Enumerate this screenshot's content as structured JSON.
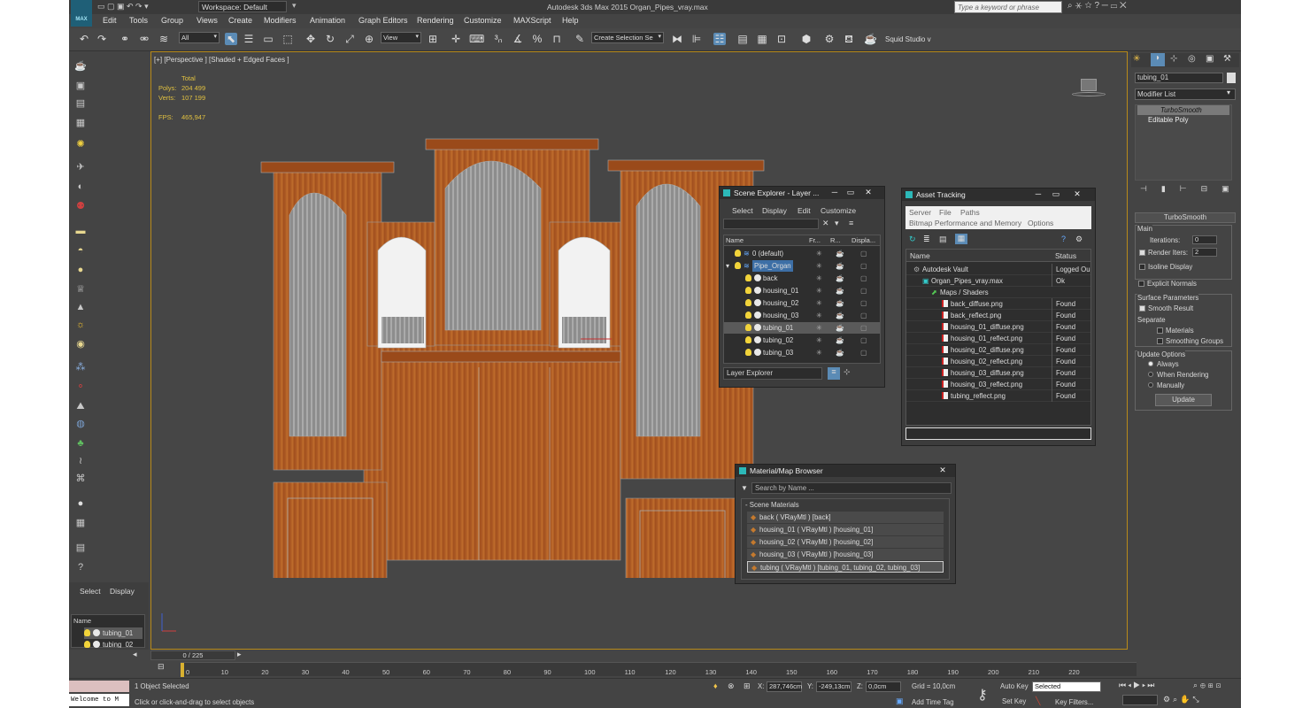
{
  "window": {
    "title": "Autodesk 3ds Max  2015    Organ_Pipes_vray.max",
    "workspace": "Workspace: Default",
    "search_placeholder": "Type a keyword or phrase",
    "logo": "MAX"
  },
  "menu": [
    "Edit",
    "Tools",
    "Group",
    "Views",
    "Create",
    "Modifiers",
    "Animation",
    "Graph Editors",
    "Rendering",
    "Customize",
    "MAXScript",
    "Help"
  ],
  "toolbar": {
    "filter": "All",
    "refcoord": "View",
    "selection_set": "Create Selection Se",
    "studio": "Squid Studio v"
  },
  "viewport": {
    "label": "[+] [Perspective ] [Shaded + Edged Faces ]",
    "stats": {
      "header": "Total",
      "polys_label": "Polys:",
      "polys": "204 499",
      "verts_label": "Verts:",
      "verts": "107 199",
      "fps_label": "FPS:",
      "fps": "465,947"
    }
  },
  "scene_explorer": {
    "title": "Scene Explorer - Layer ...",
    "menu": [
      "Select",
      "Display",
      "Edit",
      "Customize"
    ],
    "columns": [
      "Name",
      "Fr...",
      "R...",
      "Displa..."
    ],
    "rows": [
      {
        "name": "0 (default)",
        "type": "layer"
      },
      {
        "name": "Pipe_Organ",
        "type": "layer"
      },
      {
        "name": "back",
        "type": "object"
      },
      {
        "name": "housing_01",
        "type": "object"
      },
      {
        "name": "housing_02",
        "type": "object"
      },
      {
        "name": "housing_03",
        "type": "object"
      },
      {
        "name": "tubing_01",
        "type": "object"
      },
      {
        "name": "tubing_02",
        "type": "object"
      },
      {
        "name": "tubing_03",
        "type": "object"
      }
    ],
    "footer": "Layer Explorer"
  },
  "asset_tracking": {
    "title": "Asset Tracking",
    "menu": [
      "Server",
      "File",
      "Paths"
    ],
    "menu2": [
      "Bitmap Performance and Memory",
      "Options"
    ],
    "columns": [
      "Name",
      "Status"
    ],
    "rows": [
      {
        "name": "Autodesk Vault",
        "status": "Logged Ou"
      },
      {
        "name": "Organ_Pipes_vray.max",
        "status": "Ok"
      },
      {
        "name": "Maps / Shaders",
        "status": ""
      },
      {
        "name": "back_diffuse.png",
        "status": "Found"
      },
      {
        "name": "back_reflect.png",
        "status": "Found"
      },
      {
        "name": "housing_01_diffuse.png",
        "status": "Found"
      },
      {
        "name": "housing_01_reflect.png",
        "status": "Found"
      },
      {
        "name": "housing_02_diffuse.png",
        "status": "Found"
      },
      {
        "name": "housing_02_reflect.png",
        "status": "Found"
      },
      {
        "name": "housing_03_diffuse.png",
        "status": "Found"
      },
      {
        "name": "housing_03_reflect.png",
        "status": "Found"
      },
      {
        "name": "tubing_reflect.png",
        "status": "Found"
      }
    ]
  },
  "material_browser": {
    "title": "Material/Map Browser",
    "search_placeholder": "Search by Name ...",
    "group": "- Scene Materials",
    "items": [
      "back  ( VRayMtl ) [back]",
      "housing_01  ( VRayMtl ) [housing_01]",
      "housing_02  ( VRayMtl ) [housing_02]",
      "housing_03  ( VRayMtl ) [housing_03]",
      "tubing  ( VRayMtl ) [tubing_01, tubing_02, tubing_03]"
    ]
  },
  "command_panel": {
    "object_name": "tubing_01",
    "modifier_list": "Modifier List",
    "stack": [
      "TurboSmooth",
      "Editable Poly"
    ],
    "rollout": "TurboSmooth",
    "main_label": "Main",
    "iterations_label": "Iterations:",
    "iterations": "0",
    "render_iters_label": "Render Iters:",
    "render_iters": "2",
    "isoline": "Isoline Display",
    "explicit_normals": "Explicit Normals",
    "surface_params": "Surface Parameters",
    "smooth_result": "Smooth Result",
    "separate": "Separate",
    "materials": "Materials",
    "smoothing_groups": "Smoothing Groups",
    "update_options": "Update Options",
    "always": "Always",
    "when_rendering": "When Rendering",
    "manually": "Manually",
    "update_button": "Update"
  },
  "left_panel": {
    "tabs": [
      "Select",
      "Display"
    ],
    "name_header": "Name",
    "items": [
      "tubing_01",
      "tubing_02"
    ]
  },
  "timeline": {
    "frame": "0 / 225",
    "ticks": [
      "0",
      "10",
      "20",
      "30",
      "40",
      "50",
      "60",
      "70",
      "80",
      "90",
      "100",
      "110",
      "120",
      "130",
      "140",
      "150",
      "160",
      "170",
      "180",
      "190",
      "200",
      "210",
      "220"
    ]
  },
  "status": {
    "selected": "1 Object Selected",
    "prompt": "Click or click-and-drag to select objects",
    "maxscript": "Welcome to M",
    "x_label": "X:",
    "x": "287,746cm",
    "y_label": "Y:",
    "y": "-249,13cm",
    "z_label": "Z:",
    "z": "0,0cm",
    "grid": "Grid = 10,0cm",
    "add_time_tag": "Add Time Tag",
    "auto_key": "Auto Key",
    "set_key": "Set Key",
    "key_mode": "Selected",
    "key_filters": "Key Filters..."
  }
}
